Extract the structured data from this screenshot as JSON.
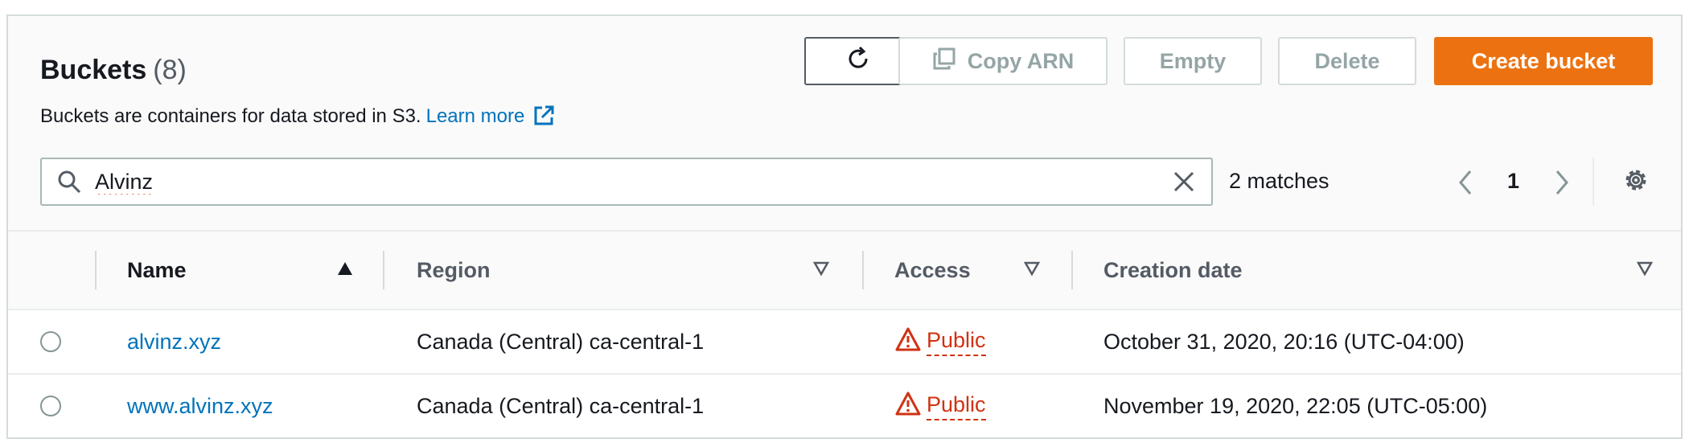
{
  "header": {
    "title": "Buckets",
    "count": "(8)",
    "description": "Buckets are containers for data stored in S3.",
    "learn_more": "Learn more"
  },
  "toolbar": {
    "refresh_icon": "refresh-icon",
    "copy_arn_label": "Copy ARN",
    "empty_label": "Empty",
    "delete_label": "Delete",
    "create_label": "Create bucket"
  },
  "search": {
    "value": "Alvinz",
    "matches": "2 matches"
  },
  "pagination": {
    "current_page": "1"
  },
  "table": {
    "columns": [
      "Name",
      "Region",
      "Access",
      "Creation date"
    ],
    "rows": [
      {
        "name": "alvinz.xyz",
        "region": "Canada (Central) ca-central-1",
        "access": "Public",
        "created": "October 31, 2020, 20:16 (UTC-04:00)"
      },
      {
        "name": "www.alvinz.xyz",
        "region": "Canada (Central) ca-central-1",
        "access": "Public",
        "created": "November 19, 2020, 22:05 (UTC-05:00)"
      }
    ]
  },
  "colors": {
    "primary_button": "#ec7211",
    "link": "#0073bb",
    "public_warning": "#d13212"
  }
}
